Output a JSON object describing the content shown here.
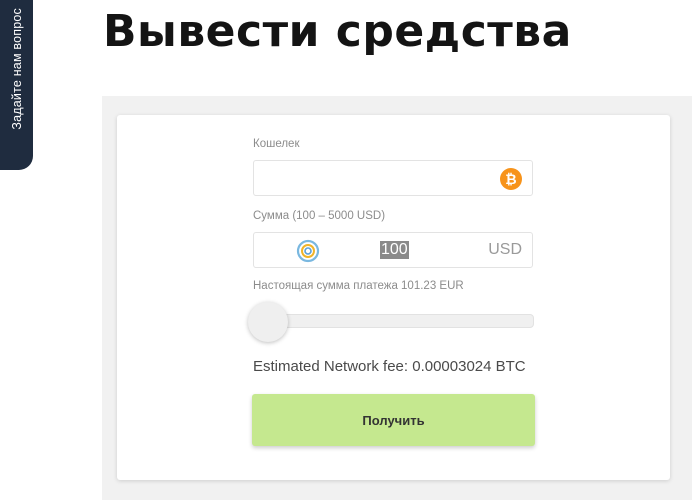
{
  "side_tab": {
    "label": "Задайте нам вопрос"
  },
  "page": {
    "title": "Вывести средства"
  },
  "form": {
    "wallet": {
      "label": "Кошелек",
      "value": "",
      "icon": "bitcoin-icon",
      "icon_color": "#f7931a",
      "icon_glyph": "₿"
    },
    "amount": {
      "label": "Сумма (100 – 5000 USD)",
      "value": "100",
      "currency": "USD",
      "icon": "refresh-icon"
    },
    "actual_amount": {
      "label": "Настоящая сумма платежа 101.23 EUR"
    },
    "slider": {
      "level": 0
    },
    "fee": {
      "text": "Estimated Network fee: 0.00003024 BTC"
    },
    "submit": {
      "label": "Получить",
      "color": "#c5e88f"
    }
  }
}
